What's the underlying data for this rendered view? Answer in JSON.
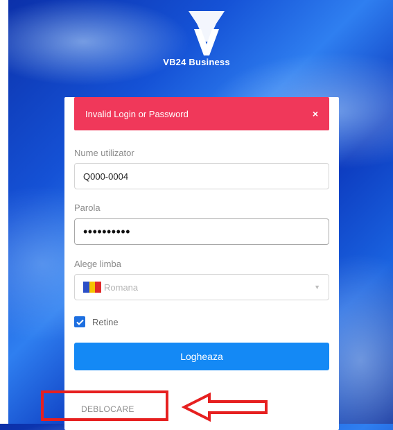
{
  "brand": {
    "name": "VB24 Business"
  },
  "alert": {
    "message": "Invalid Login or Password",
    "close_label": "×"
  },
  "form": {
    "username_label": "Nume utilizator",
    "username_value": "Q000-0004",
    "password_label": "Parola",
    "password_masked": "••••••••••",
    "language_label": "Alege limba",
    "language_value": "Romana",
    "language_flag": "romania-flag-icon",
    "remember_label": "Retine",
    "remember_checked": true,
    "login_label": "Logheaza",
    "unlock_label": "DEBLOCARE"
  },
  "annotation": {
    "highlight_color": "#e62020"
  },
  "colors": {
    "alert": "#f0385a",
    "primary_button": "#1489f5",
    "checkbox": "#1d6fe0",
    "background": "#1552d6"
  }
}
